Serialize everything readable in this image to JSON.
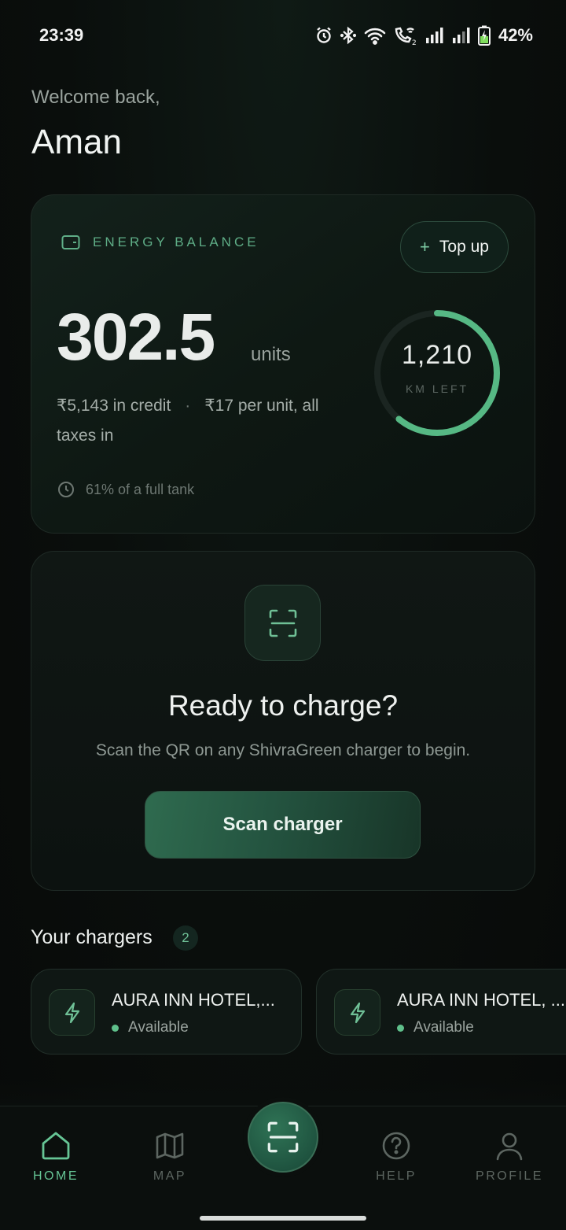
{
  "status_bar": {
    "time": "23:39",
    "battery_percent": "42%",
    "icons": [
      "alarm-icon",
      "bluetooth-icon",
      "wifi-icon",
      "wifi-call-icon",
      "signal-icon",
      "signal-icon",
      "battery-charging-icon"
    ]
  },
  "header": {
    "welcome": "Welcome back,",
    "name": "Aman"
  },
  "balance": {
    "label": "ENERGY BALANCE",
    "topup_label": "Top up",
    "units_value": "302.5",
    "units_word": "units",
    "credit": "₹5,143 in credit",
    "separator": "·",
    "rate": "₹17 per unit, all taxes in",
    "tank_note": "61% of a full tank",
    "km_value": "1,210",
    "km_label": "KM LEFT",
    "ring_fraction": 0.61
  },
  "ready": {
    "title": "Ready to charge?",
    "subtitle": "Scan the QR on any ShivraGreen charger to begin.",
    "button_label": "Scan charger"
  },
  "chargers": {
    "title": "Your chargers",
    "count": "2",
    "items": [
      {
        "name": "AURA INN HOTEL,...",
        "status": "Available"
      },
      {
        "name": "AURA INN HOTEL, ...",
        "status": "Available"
      }
    ]
  },
  "nav": {
    "items": [
      {
        "label": "HOME",
        "icon": "home-icon",
        "active": true
      },
      {
        "label": "MAP",
        "icon": "map-icon",
        "active": false
      },
      {
        "label": "HELP",
        "icon": "help-icon",
        "active": false
      },
      {
        "label": "PROFILE",
        "icon": "profile-icon",
        "active": false
      }
    ],
    "center_icon": "scan-icon"
  },
  "colors": {
    "accent": "#5fc08b",
    "background": "#0a0e0c"
  }
}
